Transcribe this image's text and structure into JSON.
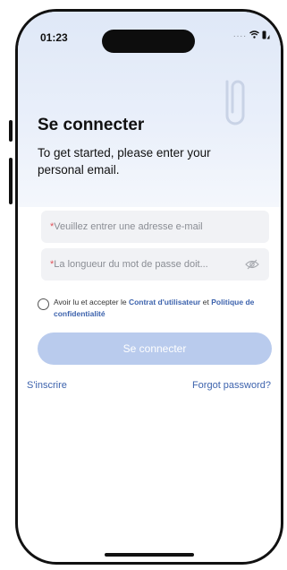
{
  "status_bar": {
    "time": "01:23",
    "signal_dots": "....",
    "icons": [
      "wifi-icon",
      "battery-icon"
    ]
  },
  "header": {
    "title": "Se connecter",
    "subtitle": "To get started, please enter your personal email.",
    "decoration_icon": "paperclip-icon"
  },
  "form": {
    "email": {
      "required_mark": "*",
      "placeholder": "Veuillez entrer une adresse e-mail"
    },
    "password": {
      "required_mark": "*",
      "placeholder": "La longueur du mot de passe doit...",
      "toggle_icon": "eye-hidden-icon"
    },
    "terms": {
      "prefix": "Avoir lu et accepter le ",
      "user_agreement": "Contrat d'utilisateur",
      "conjunction": " et ",
      "privacy_policy": "Politique de confidentialité",
      "checked": false
    },
    "submit_label": "Se connecter"
  },
  "footer_links": {
    "signup": "S'inscrire",
    "forgot": "Forgot password?"
  },
  "colors": {
    "accent": "#3d63ad",
    "button_disabled": "#b9cbed",
    "required": "#e0545b",
    "hero_bg": "#dfe8f7"
  }
}
